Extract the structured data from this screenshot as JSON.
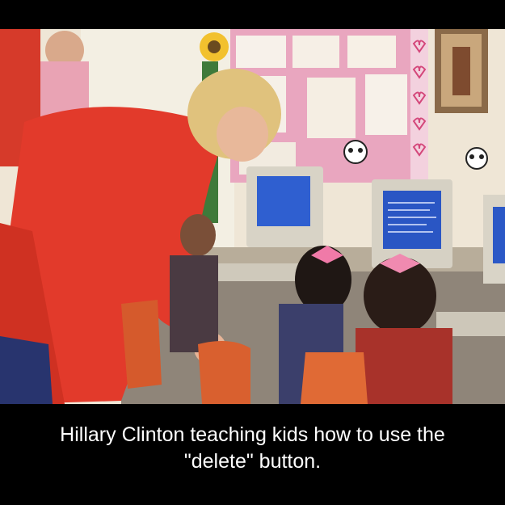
{
  "caption": {
    "line1": "Hillary Clinton teaching kids how to use the",
    "line2": "\"delete\" button."
  },
  "colors": {
    "background": "#000000",
    "caption_text": "#ffffff",
    "red_suit": "#e23a2b",
    "monitor_screen": "#2f5fd0"
  },
  "scene": {
    "description_icon": "classroom-photo"
  }
}
